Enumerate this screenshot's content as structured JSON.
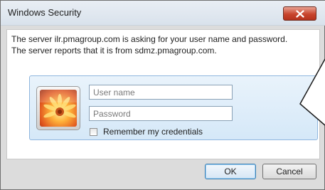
{
  "window": {
    "title": "Windows Security"
  },
  "message": {
    "line1": "The server ilr.pmagroup.com is asking for your user name and password.",
    "line2": "The server reports that it is from sdmz.pmagroup.com."
  },
  "credentials": {
    "username_placeholder": "User name",
    "username_value": "",
    "password_placeholder": "Password",
    "password_value": "",
    "remember_label": "Remember my credentials",
    "remember_checked": false
  },
  "buttons": {
    "ok_label": "OK",
    "cancel_label": "Cancel"
  },
  "icons": {
    "close": "close-icon",
    "avatar": "flower-avatar-icon"
  },
  "colors": {
    "close_button": "#c8452e",
    "tile_background": "#dcebf9",
    "tile_border": "#8fb6de",
    "ok_border": "#3c7fb1"
  }
}
